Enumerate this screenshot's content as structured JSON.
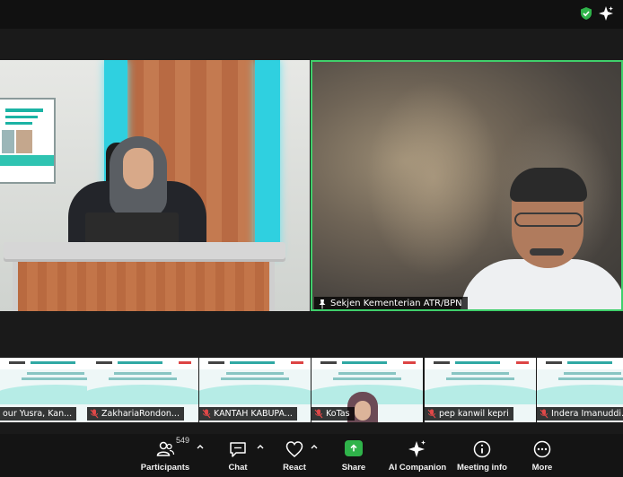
{
  "colors": {
    "active_speaker_border": "#3fcf6b",
    "share_green": "#2fb34a",
    "toolbar_bg": "#141414",
    "background": "#1a1a1a"
  },
  "topbar": {
    "icons": [
      "shield-check-icon",
      "sparkle-icon"
    ]
  },
  "videos": {
    "main_speaker_name": "Sekjen Kementerian ATR/BPN"
  },
  "thumbnails": [
    {
      "name": "our Yusra, Kan..."
    },
    {
      "name": "ZakhariaRondon..."
    },
    {
      "name": "KANTAH KABUPA..."
    },
    {
      "name": "KoTas"
    },
    {
      "name": "pep kanwil kepri"
    },
    {
      "name": "Indera Imanuddi..."
    }
  ],
  "toolbar": {
    "participants_label": "Participants",
    "participants_count": "549",
    "chat_label": "Chat",
    "react_label": "React",
    "share_label": "Share",
    "ai_label": "AI Companion",
    "meeting_info_label": "Meeting info",
    "more_label": "More"
  }
}
